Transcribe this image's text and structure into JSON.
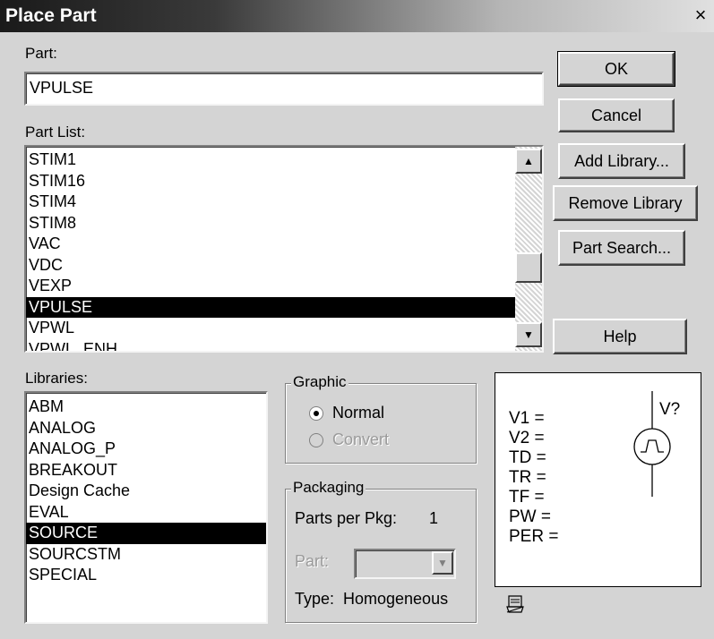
{
  "window": {
    "title": "Place Part",
    "close_glyph": "×"
  },
  "part": {
    "label": "Part:",
    "value": "VPULSE"
  },
  "part_list": {
    "label": "Part List:",
    "items": [
      "STIM1",
      "STIM16",
      "STIM4",
      "STIM8",
      "VAC",
      "VDC",
      "VEXP",
      "VPULSE",
      "VPWL",
      "VPWL_ENH"
    ],
    "selected_index": 7
  },
  "libraries": {
    "label": "Libraries:",
    "items": [
      "ABM",
      "ANALOG",
      "ANALOG_P",
      "BREAKOUT",
      "Design Cache",
      "EVAL",
      "SOURCE",
      "SOURCSTM",
      "SPECIAL"
    ],
    "selected_index": 6
  },
  "buttons": {
    "ok": "OK",
    "cancel": "Cancel",
    "add_library": "Add Library...",
    "remove_library": "Remove Library",
    "part_search": "Part Search...",
    "help": "Help"
  },
  "graphic": {
    "legend": "Graphic",
    "normal": "Normal",
    "convert": "Convert",
    "selected": "Normal"
  },
  "packaging": {
    "legend": "Packaging",
    "parts_per_pkg_label": "Parts per Pkg:",
    "parts_per_pkg_value": "1",
    "part_label": "Part:",
    "type_label": "Type:",
    "type_value": "Homogeneous"
  },
  "preview": {
    "params": [
      "V1 =",
      "V2 =",
      "TD =",
      "TR =",
      "TF =",
      "PW =",
      "PER ="
    ],
    "ref": "V?"
  },
  "icons": {
    "scroll_up": "scroll-up-arrow",
    "scroll_down": "scroll-down-arrow",
    "dropdown": "dropdown-arrow",
    "status": "part-status-icon"
  }
}
